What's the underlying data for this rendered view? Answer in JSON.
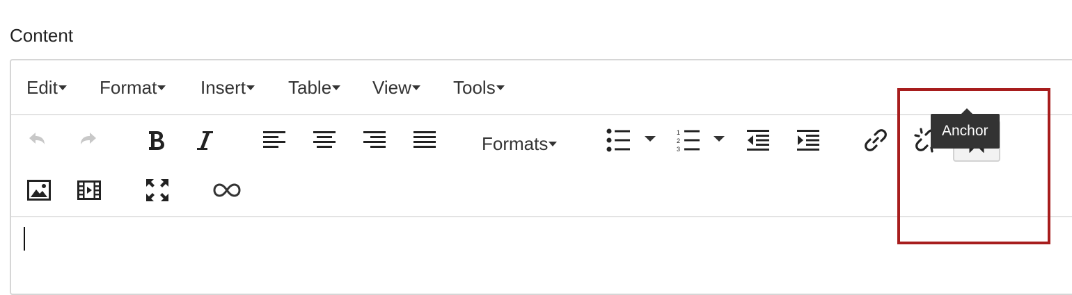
{
  "field": {
    "label": "Content"
  },
  "menubar": {
    "items": [
      {
        "label": "Edit"
      },
      {
        "label": "Format"
      },
      {
        "label": "Insert"
      },
      {
        "label": "Table"
      },
      {
        "label": "View"
      },
      {
        "label": "Tools"
      }
    ]
  },
  "toolbar": {
    "formats_label": "Formats",
    "buttons": [
      {
        "icon": "undo-icon",
        "state": "disabled"
      },
      {
        "icon": "redo-icon",
        "state": "disabled"
      },
      {
        "icon": "bold-icon"
      },
      {
        "icon": "italic-icon"
      },
      {
        "icon": "align-left-icon"
      },
      {
        "icon": "align-center-icon"
      },
      {
        "icon": "align-right-icon"
      },
      {
        "icon": "align-justify-icon"
      },
      {
        "icon": "bullet-list-icon"
      },
      {
        "icon": "numbered-list-icon"
      },
      {
        "icon": "outdent-icon"
      },
      {
        "icon": "indent-icon"
      },
      {
        "icon": "link-icon"
      },
      {
        "icon": "unlink-icon"
      },
      {
        "icon": "anchor-icon",
        "state": "hovered"
      },
      {
        "icon": "image-icon"
      },
      {
        "icon": "media-icon"
      },
      {
        "icon": "fullscreen-icon"
      },
      {
        "icon": "infinity-icon"
      }
    ]
  },
  "tooltip": {
    "text": "Anchor"
  },
  "colors": {
    "highlight": "#a71d1d",
    "tooltip_bg": "#333333",
    "disabled_icon": "#c8c8c8",
    "icon": "#222222"
  }
}
